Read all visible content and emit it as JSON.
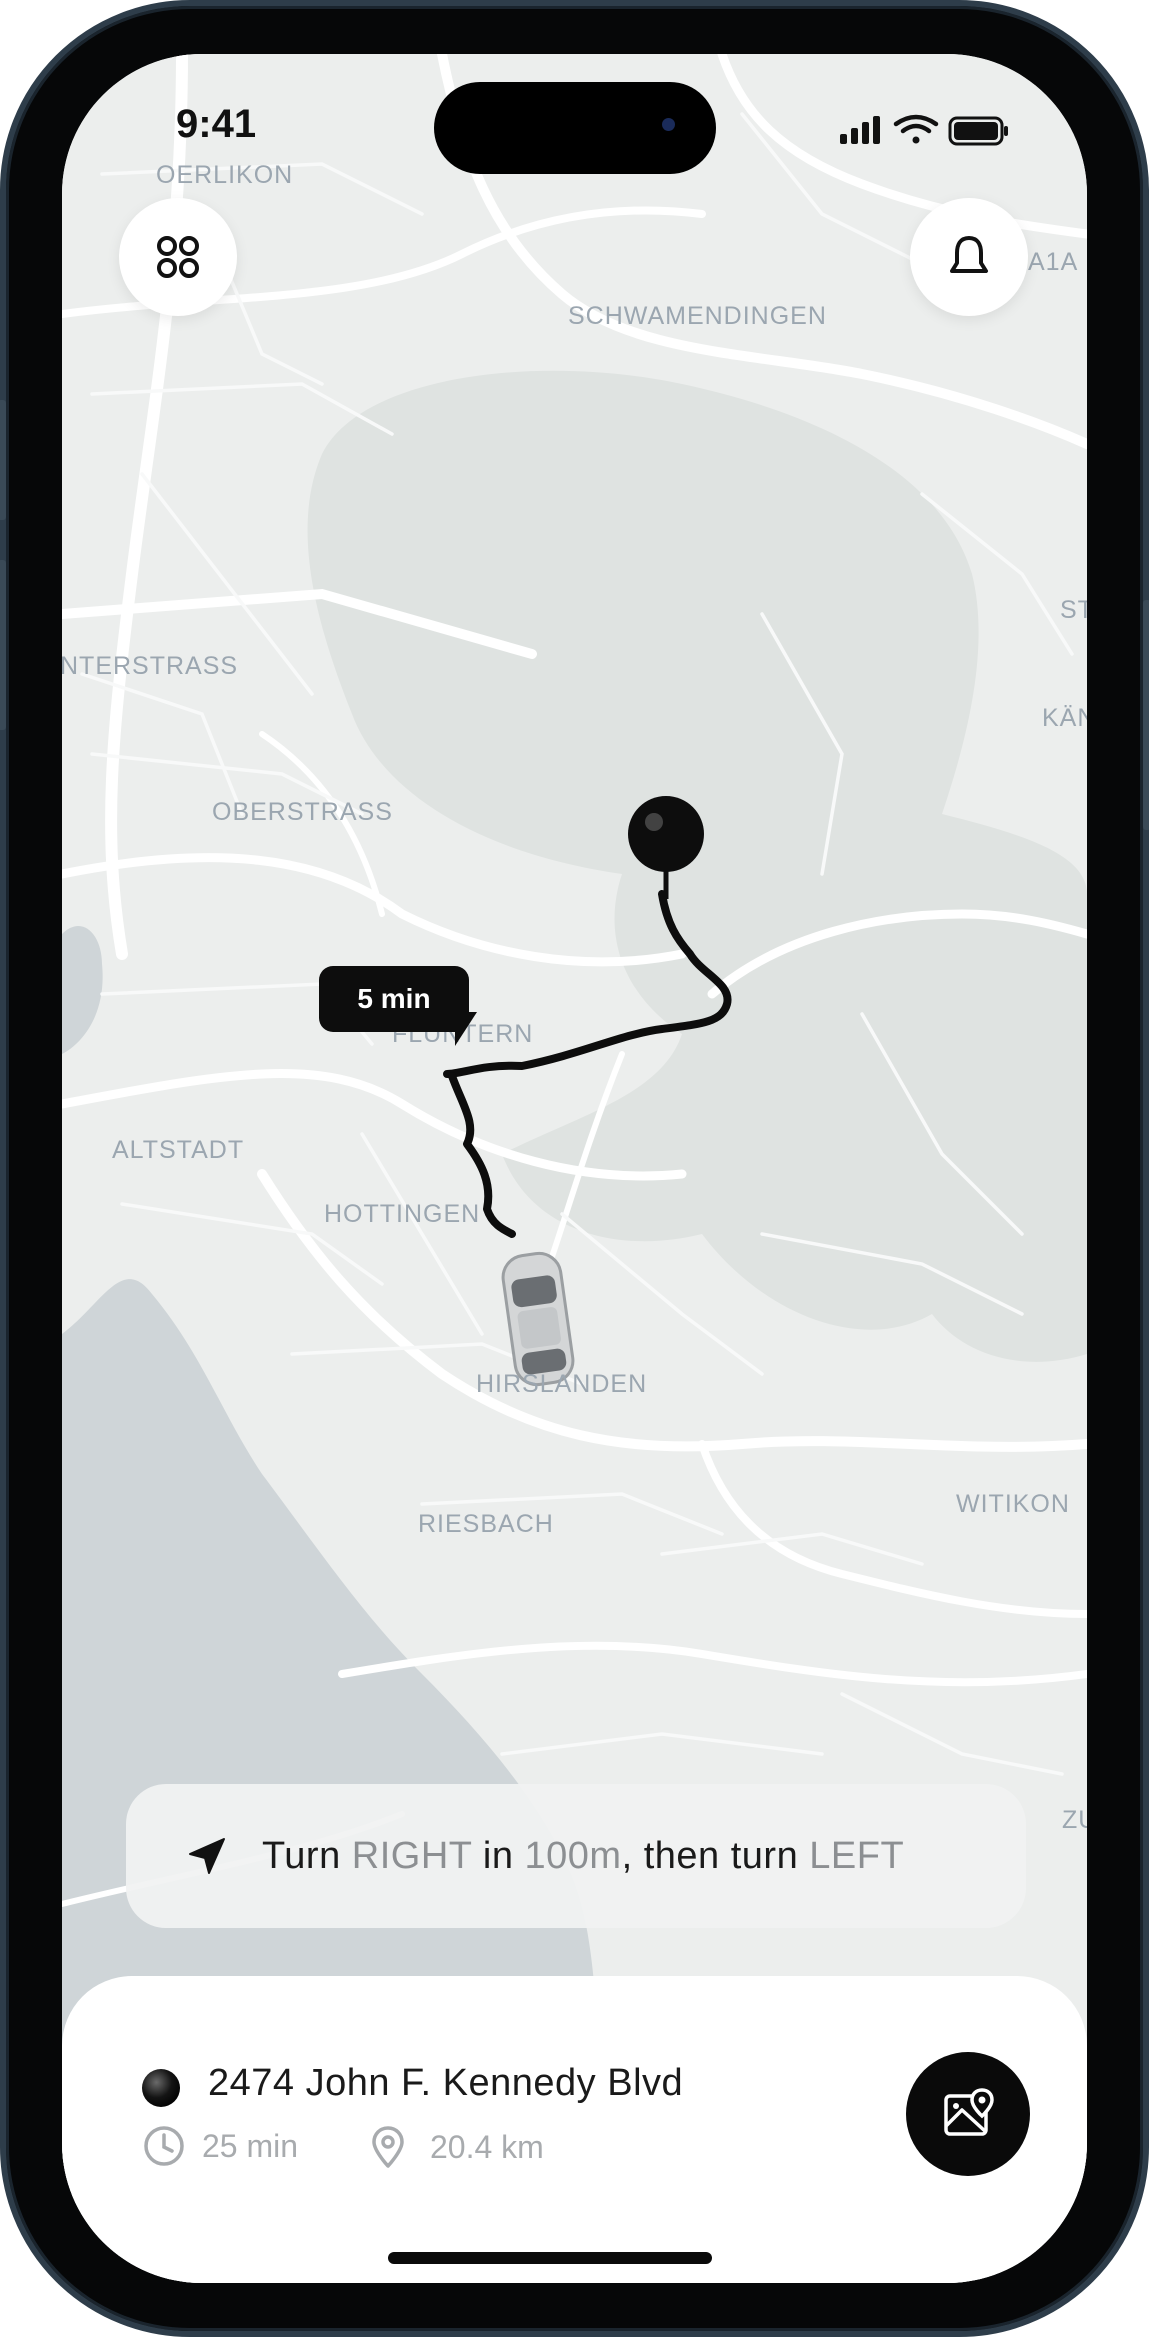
{
  "status_bar": {
    "time": "9:41"
  },
  "map": {
    "labels": [
      "OERLIKON",
      "SCHWAMENDINGEN",
      "NTERSTRASS",
      "OBERSTRASS",
      "FLUNTERN",
      "ALTSTADT",
      "HOTTINGEN",
      "HIRSLANDEN",
      "RIESBACH",
      "WITIKON",
      "A1A",
      "ST",
      "KÄN",
      "ZU"
    ]
  },
  "route": {
    "eta_bubble": "5 min"
  },
  "navigation": {
    "instruction": {
      "w1": "Turn",
      "d1": "RIGHT",
      "w2": "in",
      "d2": "100m",
      "w3": ", then turn",
      "d3": "LEFT"
    }
  },
  "destination": {
    "name": "2474 John F. Kennedy Blvd",
    "duration": "25 min",
    "distance": "20.4 km"
  },
  "icons": {
    "menu": "grid-icon",
    "notifications": "bell-icon",
    "navigation": "navigation-arrow-icon",
    "duration": "clock-icon",
    "distance": "location-pin-icon",
    "map_view": "map-icon"
  },
  "colors": {
    "accent": "#0a0a0a",
    "map_background": "#eceeed",
    "map_label": "#9ba6b0",
    "water": "#cfd5d8"
  }
}
